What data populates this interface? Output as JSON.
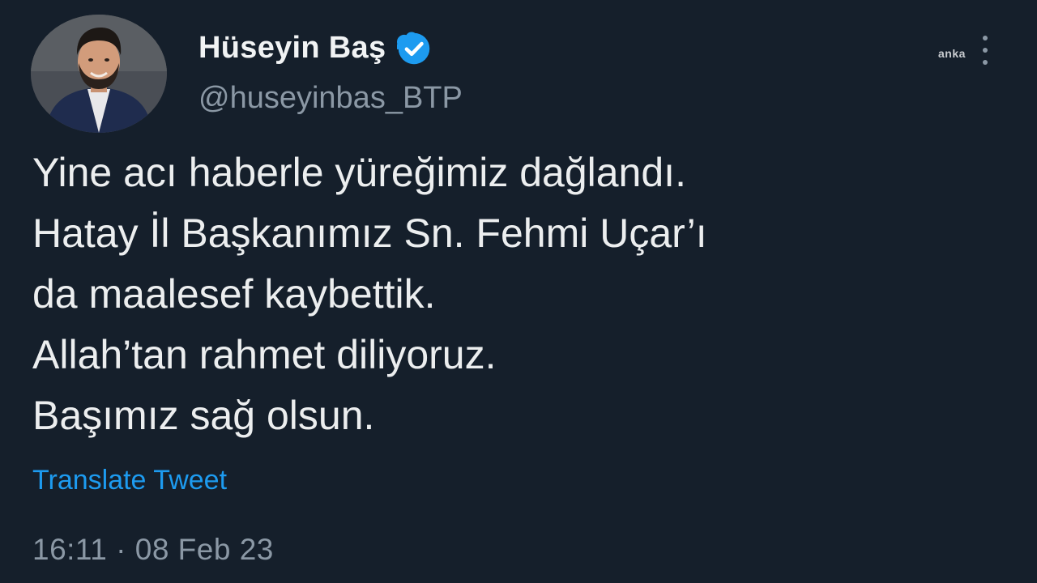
{
  "tweet": {
    "author": {
      "display_name": "Hüseyin Baş",
      "handle": "@huseyinbas_BTP",
      "verified_icon": "verified-badge-icon"
    },
    "watermark": "anka",
    "more_icon": "more-options-icon",
    "lines": [
      "Yine acı haberle yüreğimiz dağlandı.",
      "Hatay İl Başkanımız Sn. Fehmi Uçar’ı",
      "da maalesef kaybettik.",
      "Allah’tan rahmet diliyoruz.",
      "Başımız sağ olsun."
    ],
    "translate_label": "Translate Tweet",
    "time": "16:11",
    "separator": "·",
    "date": "08 Feb 23"
  },
  "colors": {
    "background": "#151f2b",
    "text": "#eceeef",
    "secondary": "#8b98a5",
    "link": "#1d9bf0",
    "verified": "#1d9bf0"
  }
}
